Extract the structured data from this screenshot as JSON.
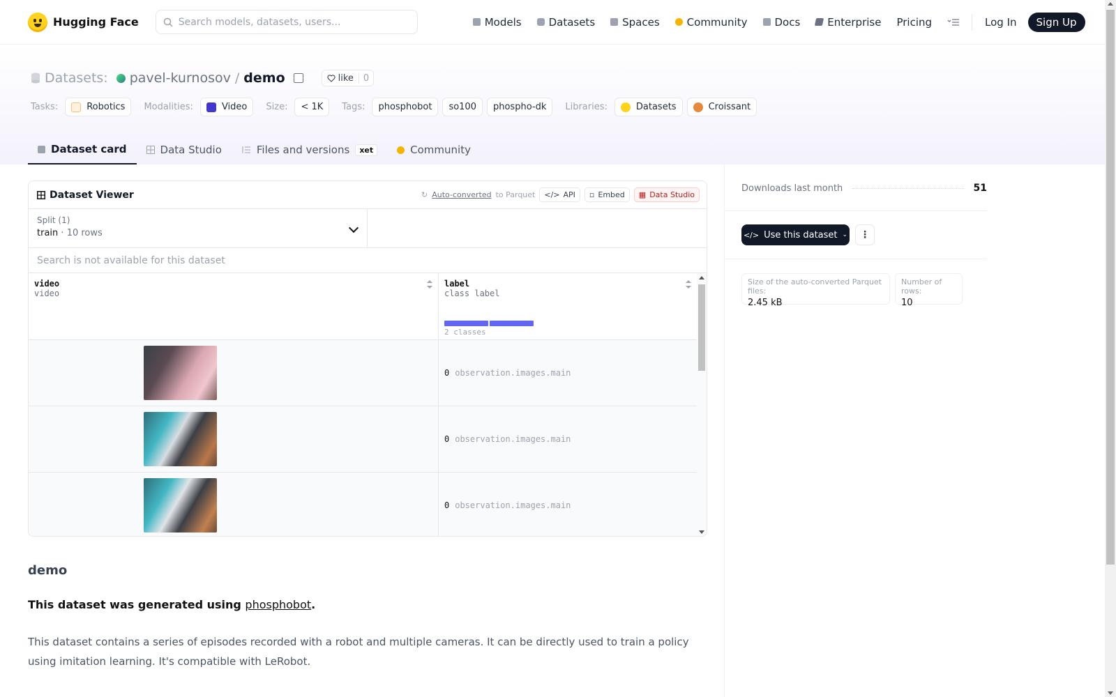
{
  "header": {
    "brand": "Hugging Face",
    "search_placeholder": "Search models, datasets, users...",
    "nav": [
      {
        "label": "Models",
        "icon": "models-icon",
        "color": "#9ca3af"
      },
      {
        "label": "Datasets",
        "icon": "datasets-icon",
        "color": "#9ca3af"
      },
      {
        "label": "Spaces",
        "icon": "spaces-icon",
        "color": "#9ca3af"
      },
      {
        "label": "Community",
        "icon": "community-icon",
        "color": "#f5b400"
      },
      {
        "label": "Docs",
        "icon": "docs-icon",
        "color": "#9ca3af"
      },
      {
        "label": "Enterprise",
        "icon": "enterprise-icon",
        "color": "#6b7280"
      },
      {
        "label": "Pricing"
      }
    ],
    "login": "Log In",
    "signup": "Sign Up"
  },
  "repo": {
    "type_label": "Datasets:",
    "owner": "pavel-kurnosov",
    "slash": "/",
    "name": "demo",
    "like_label": "like",
    "like_count": "0"
  },
  "tags": {
    "tasks_label": "Tasks:",
    "tasks": [
      "Robotics"
    ],
    "modalities_label": "Modalities:",
    "modalities": [
      "Video"
    ],
    "size_label": "Size:",
    "size": "< 1K",
    "tags_label": "Tags:",
    "tags": [
      "phosphobot",
      "so100",
      "phospho-dk"
    ],
    "libraries_label": "Libraries:",
    "libraries": [
      "Datasets",
      "Croissant"
    ]
  },
  "tabs": [
    {
      "label": "Dataset card",
      "active": true
    },
    {
      "label": "Data Studio"
    },
    {
      "label": "Files and versions",
      "badge": "xet"
    },
    {
      "label": "Community"
    }
  ],
  "viewer": {
    "title": "Dataset Viewer",
    "auto_converted": "Auto-converted",
    "to_parquet": "to Parquet",
    "api": "API",
    "embed": "Embed",
    "data_studio": "Data Studio",
    "split_label": "Split (1)",
    "split_value": "train",
    "split_dot": "·",
    "split_rows": "10 rows",
    "search_na": "Search is not available for this dataset",
    "columns": [
      {
        "name": "video",
        "type": "video"
      },
      {
        "name": "label",
        "type": "class label",
        "summary": "2 classes"
      }
    ],
    "class_bar_fractions": [
      0.5,
      0.5
    ],
    "rows": [
      {
        "label_index": "0",
        "label_text": "observation.images.main",
        "thumb": "pink"
      },
      {
        "label_index": "0",
        "label_text": "observation.images.main",
        "thumb": "teal"
      },
      {
        "label_index": "0",
        "label_text": "observation.images.main",
        "thumb": "teal"
      }
    ]
  },
  "card": {
    "heading": "demo",
    "generated_prefix": "This dataset was generated using ",
    "generated_link": "phosphobot",
    "generated_suffix": ".",
    "description": "This dataset contains a series of episodes recorded with a robot and multiple cameras. It can be directly used to train a policy using imitation learning. It's compatible with LeRobot."
  },
  "sidebar": {
    "downloads_label": "Downloads last month",
    "downloads_value": "51",
    "use_button": "Use this dataset",
    "parquet_size_label": "Size of the auto-converted Parquet files:",
    "parquet_size_value": "2.45 kB",
    "rows_label": "Number of rows:",
    "rows_value": "10"
  }
}
